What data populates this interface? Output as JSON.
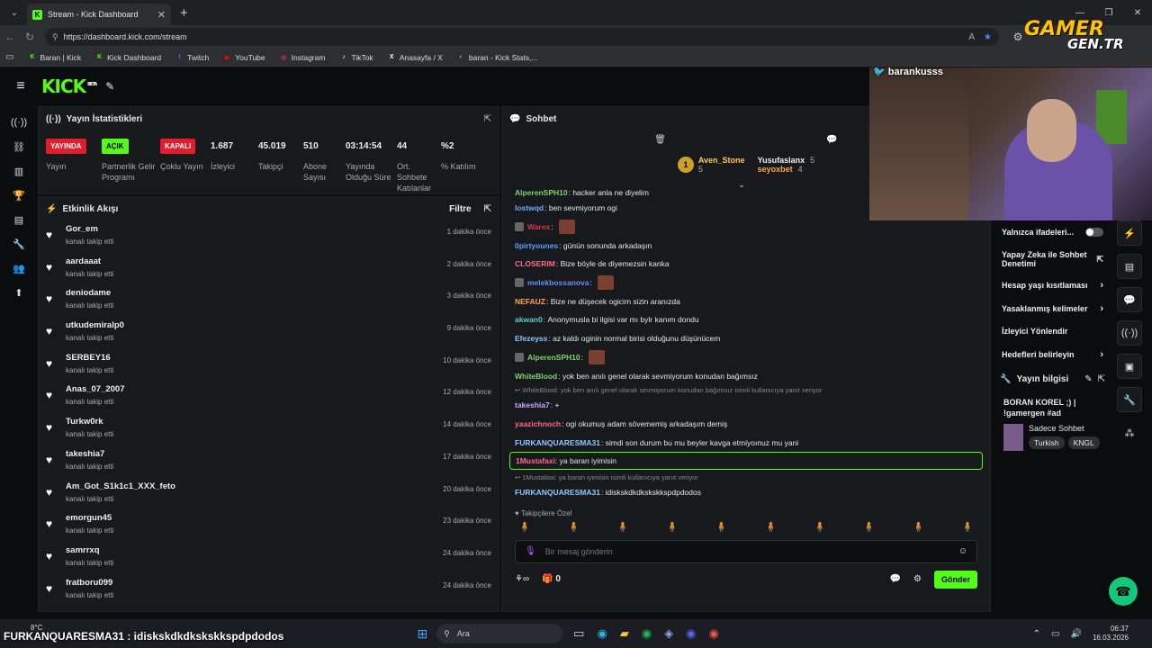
{
  "browser": {
    "tab_title": "Stream - Kick Dashboard",
    "tab_favicon": "K",
    "url": "https://dashboard.kick.com/stream",
    "bookmarks": [
      {
        "label": "Baran | Kick",
        "icon": "K",
        "color": "#53fc18"
      },
      {
        "label": "Kick Dashboard",
        "icon": "K",
        "color": "#53fc18"
      },
      {
        "label": "Twitch",
        "icon": "t",
        "color": "#9146ff"
      },
      {
        "label": "YouTube",
        "icon": "▶",
        "color": "#ff0000"
      },
      {
        "label": "Instagram",
        "icon": "◎",
        "color": "#e1306c"
      },
      {
        "label": "TikTok",
        "icon": "♪",
        "color": "#ffffff"
      },
      {
        "label": "Anasayfa / X",
        "icon": "X",
        "color": "#ffffff"
      },
      {
        "label": "baran - Kick Stats,...",
        "icon": "◐",
        "color": "#7aa6ff"
      }
    ]
  },
  "kick": {
    "logo": "KICK",
    "logo_sup": "BETA"
  },
  "stats": {
    "title": "Yayın İstatistikleri",
    "items": [
      {
        "badge": "YAYINDA",
        "badge_color": "red",
        "label": "Yayın"
      },
      {
        "badge": "AÇIK",
        "badge_color": "green",
        "label": "Partnerlik Gelir Programı"
      },
      {
        "badge": "KAPALI",
        "badge_color": "red",
        "label": "Çoklu Yayın"
      },
      {
        "value": "1.687",
        "label": "İzleyici"
      },
      {
        "value": "45.019",
        "label": "Takipçi"
      },
      {
        "value": "510",
        "label": "Abone Sayısı"
      },
      {
        "value": "03:14:54",
        "label": "Yayında Olduğu Süre"
      },
      {
        "value": "44",
        "label": "Ort. Sohbete Katılanlar"
      },
      {
        "value": "%2",
        "label": "% Katılım"
      }
    ]
  },
  "feed": {
    "title": "Etkinlik Akışı",
    "filter": "Filtre",
    "items": [
      {
        "name": "Gor_em",
        "sub": "kanalı takip etti",
        "time": "1 dakika önce"
      },
      {
        "name": "aardaaat",
        "sub": "kanalı takip etti",
        "time": "2 dakika önce"
      },
      {
        "name": "deniodame",
        "sub": "kanalı takip etti",
        "time": "3 dakika önce"
      },
      {
        "name": "utkudemiralp0",
        "sub": "kanalı takip etti",
        "time": "9 dakika önce"
      },
      {
        "name": "SERBEY16",
        "sub": "kanalı takip etti",
        "time": "10 dakika önce"
      },
      {
        "name": "Anas_07_2007",
        "sub": "kanalı takip etti",
        "time": "12 dakika önce"
      },
      {
        "name": "Turkw0rk",
        "sub": "kanalı takip etti",
        "time": "14 dakika önce"
      },
      {
        "name": "takeshia7",
        "sub": "kanalı takip etti",
        "time": "17 dakika önce"
      },
      {
        "name": "Am_Got_S1k1c1_XXX_feto",
        "sub": "kanalı takip etti",
        "time": "20 dakika önce"
      },
      {
        "name": "emorgun45",
        "sub": "kanalı takip etti",
        "time": "23 dakika önce"
      },
      {
        "name": "samrrxq",
        "sub": "kanalı takip etti",
        "time": "24 dakika önce"
      },
      {
        "name": "fratboru099",
        "sub": "kanalı takip etti",
        "time": "24 dakika önce"
      }
    ]
  },
  "chat": {
    "title": "Sohbet",
    "leaderboard": [
      {
        "rank": "1",
        "name": "Aven_Stone",
        "count": "5"
      },
      {
        "name": "Yusufaslanx",
        "count": "5"
      },
      {
        "name": "seyoxbet",
        "count": "4"
      }
    ],
    "messages": [
      {
        "user": "AlperenSPH10",
        "color": "#7fd36a",
        "text": "hacker anla ne diyelim",
        "emote": false,
        "avatar": false
      },
      {
        "user": "lostwqd",
        "color": "#7aa6ff",
        "text": "ben sevmiyorum ogi",
        "emote": false,
        "avatar": false
      },
      {
        "user": "Warex",
        "color": "#e0334a",
        "text": "",
        "emote": true,
        "avatar": true
      },
      {
        "user": "0pirtyounes",
        "color": "#5aa0ff",
        "text": "günün sonunda arkadaşın",
        "emote": false,
        "avatar": false
      },
      {
        "user": "CLOSERIM",
        "color": "#ff6b8a",
        "text": "Bize böyle de diyemezsin kanka",
        "emote": false,
        "avatar": false
      },
      {
        "user": "melekbossanova",
        "color": "#6a8cff",
        "text": "",
        "emote": true,
        "avatar": true
      },
      {
        "user": "NEFAUZ",
        "color": "#ffa64d",
        "text": "Bize ne düşecek ogicim sizin aranızda",
        "emote": false,
        "avatar": false
      },
      {
        "user": "akwan0",
        "color": "#5ad1c4",
        "text": "Anonymusla bi ilgisi var mı bylr kanım dondu",
        "emote": false,
        "avatar": false
      },
      {
        "user": "Efezeyss",
        "color": "#8ec8ff",
        "text": "az kaldı oginin normal birisi olduğunu düşünücem",
        "emote": false,
        "avatar": false
      },
      {
        "user": "AlperenSPH10",
        "color": "#7fd36a",
        "text": "",
        "emote": true,
        "avatar": true
      },
      {
        "user": "WhiteBlood",
        "color": "#7fd36a",
        "text": "yok ben anılı genel olarak sevmiyorum konudan bağımsız",
        "emote": false,
        "avatar": false
      }
    ],
    "reply1": "↩ WhiteBlood: yok ben anılı genel olarak sevmiyorum konudan bağımsız isimli kullanıcıya yanıt veriyor",
    "msg_reply1": {
      "user": "takeshia7",
      "color": "#c7a6ff",
      "text": "+"
    },
    "msg_yaazich": {
      "user": "yaazichnoch",
      "color": "#ff6b8a",
      "text": "ogi okumuş adam sövememiş arkadaşım demiş"
    },
    "msg_furk1": {
      "user": "FURKANQUARESMA31",
      "color": "#8fc9ff",
      "text": "simdi son durum bu mu beyler kavga etmiyoınuz mu yani"
    },
    "highlight": {
      "user": "1Mustafaxi",
      "color": "#ff6b8a",
      "text": "ya baran iyimisin"
    },
    "reply2": "↩ 1Mustafaxi: ya baran iyimisin isimli kullanıcıya yanıt veriyor",
    "msg_furk2": {
      "user": "FURKANQUARESMA31",
      "color": "#8fc9ff",
      "text": "idiskskdkdkskskkspdpdodos"
    },
    "followers_only": "♥ Takipçilere Özel",
    "placeholder": "Bir mesaj gönderin",
    "points": "0",
    "send": "Gönder"
  },
  "rightpanel": {
    "items": [
      {
        "label": "Yalnızca ifadeleri...",
        "kind": "toggle"
      },
      {
        "label": "Yapay Zeka ile Sohbet Denetimi",
        "kind": "ext"
      },
      {
        "label": "Hesap yaşı kısıtlaması",
        "kind": "chev"
      },
      {
        "label": "Yasaklanmış kelimeler",
        "kind": "chev"
      },
      {
        "label": "İzleyici Yönlendir",
        "kind": "none"
      },
      {
        "label": "Hedefleri belirleyin",
        "kind": "chev"
      }
    ],
    "info_title": "Yayın bilgisi",
    "stream_title": "BORAN KOREL ;) | !gamergen #ad",
    "category": "Sadece Sohbet",
    "tags": [
      "Turkish",
      "KNGL"
    ]
  },
  "overlay": {
    "watermark_top": "GAMER",
    "watermark_bottom": "GEN.TR",
    "twitter_handle": "barankusss",
    "ticker": "FURKANQUARESMA31 : idiskskdkdkskskkspdpdodos"
  },
  "taskbar": {
    "weather": "8°C",
    "search": "Ara",
    "time": "06:37",
    "date": "16.03.2026"
  }
}
